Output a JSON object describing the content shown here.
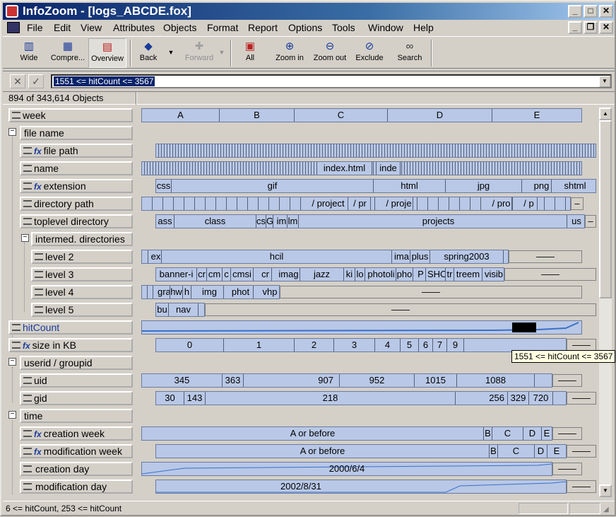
{
  "window": {
    "title": "InfoZoom - [logs_ABCDE.fox]"
  },
  "menu": [
    "File",
    "Edit",
    "View",
    "Attributes",
    "Objects",
    "Format",
    "Report",
    "Options",
    "Tools",
    "Window",
    "Help"
  ],
  "toolbar": {
    "wide": "Wide",
    "compress": "Compre...",
    "overview": "Overview",
    "back": "Back",
    "forward": "Forward",
    "all": "All",
    "zoom_in": "Zoom in",
    "zoom_out": "Zoom out",
    "exclude": "Exclude",
    "search": "Search"
  },
  "query": {
    "value": "1551 <= hitCount <= 3567"
  },
  "count": "894 of 343,614 Objects",
  "attributes": {
    "week": {
      "label": "week",
      "segments": [
        "A",
        "B",
        "C",
        "D",
        "E"
      ]
    },
    "file_name": {
      "label": "file name"
    },
    "file_path": {
      "label": "file path"
    },
    "name": {
      "label": "name",
      "values": [
        "index.html",
        "inde"
      ]
    },
    "extension": {
      "label": "extension",
      "values": [
        "css",
        "gif",
        "html",
        "jpg",
        "png",
        "shtml"
      ]
    },
    "directory_path": {
      "label": "directory path",
      "values": [
        "/ project",
        "/ pr",
        "/ proje",
        "/ pro",
        "/ p"
      ]
    },
    "toplevel_directory": {
      "label": "toplevel directory",
      "values": [
        "ass",
        "class",
        "cs",
        "G",
        "im",
        "lm",
        "projects",
        "us"
      ]
    },
    "intermed_directories": {
      "label": "intermed. directories"
    },
    "level2": {
      "label": "level 2",
      "values": [
        "ex",
        "hcil",
        "ima",
        "plus",
        "spring2003"
      ]
    },
    "level3": {
      "label": "level 3",
      "values": [
        "banner-i",
        "cr",
        "cm",
        "c",
        "cmsi",
        "cr",
        "imag",
        "jazz",
        "ki",
        "lo",
        "photoli",
        "pho",
        "P",
        "SHO",
        "tr",
        "treem",
        "visib"
      ]
    },
    "level4": {
      "label": "level 4",
      "values": [
        "gra",
        "hw",
        "h",
        "img",
        "phot",
        "vhp"
      ]
    },
    "level5": {
      "label": "level 5",
      "values": [
        "bu",
        "nav"
      ]
    },
    "hitcount": {
      "label": "hitCount"
    },
    "size_kb": {
      "label": "size in KB",
      "values": [
        "0",
        "1",
        "2",
        "3",
        "4",
        "5",
        "6",
        "7",
        "9"
      ]
    },
    "userid_groupid": {
      "label": "userid / groupid"
    },
    "uid": {
      "label": "uid",
      "values": [
        "345",
        "363",
        "907",
        "952",
        "1015",
        "1088"
      ]
    },
    "gid": {
      "label": "gid",
      "values": [
        "30",
        "143",
        "218",
        "256",
        "329",
        "720"
      ]
    },
    "time": {
      "label": "time"
    },
    "creation_week": {
      "label": "creation week",
      "values": [
        "A or before",
        "B",
        "C",
        "D",
        "E"
      ]
    },
    "modification_week": {
      "label": "modification week",
      "values": [
        "A or before",
        "B",
        "C",
        "D",
        "E"
      ]
    },
    "creation_day": {
      "label": "creation day",
      "value": "2000/6/4"
    },
    "modification_day": {
      "label": "modification day",
      "value": "2002/8/31"
    }
  },
  "dash": "——",
  "tooltip": "1551 <= hitCount <= 3567",
  "status": "6 <= hitCount, 253 <= hitCount"
}
